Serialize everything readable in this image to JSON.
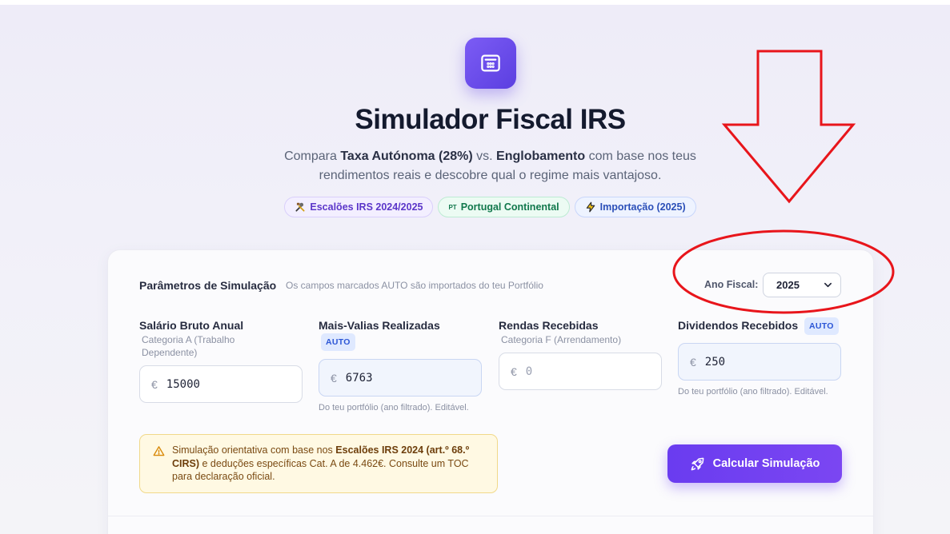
{
  "header": {
    "title": "Simulador Fiscal IRS",
    "subtitle_parts": {
      "p1": "Compara ",
      "b1": "Taxa Autónoma (28%)",
      "p2": " vs. ",
      "b2": "Englobamento",
      "p3": " com base nos teus rendimentos reais e descobre qual o regime mais vantajoso."
    },
    "badges": [
      {
        "icon": "tools-icon",
        "label": "Escalões IRS 2024/2025"
      },
      {
        "icon": "pt-flag-icon",
        "icon_text": "PT",
        "label": "Portugal Continental"
      },
      {
        "icon": "lightning-icon",
        "label": "Importação (2025)"
      }
    ]
  },
  "params": {
    "title": "Parâmetros de Simulação",
    "hint": "Os campos marcados AUTO são importados do teu Portfólio",
    "year_label": "Ano Fiscal:",
    "year_value": "2025"
  },
  "fields": [
    {
      "label": "Salário Bruto Anual",
      "sub": "Categoria A (Trabalho Dependente)",
      "currency": "€",
      "value": "15000",
      "auto": false
    },
    {
      "label": "Mais-Valias Realizadas",
      "auto_tag": "AUTO",
      "currency": "€",
      "value": "6763",
      "auto": true,
      "helper": "Do teu portfólio (ano filtrado). Editável."
    },
    {
      "label": "Rendas Recebidas",
      "sub": "Categoria F (Arrendamento)",
      "currency": "€",
      "placeholder": "0",
      "auto": false
    },
    {
      "label": "Dividendos Recebidos",
      "auto_tag": "AUTO",
      "currency": "€",
      "value": "250",
      "auto": true,
      "helper": "Do teu portfólio (ano filtrado). Editável."
    }
  ],
  "notice": {
    "p1": "Simulação orientativa com base nos ",
    "b1": "Escalões IRS 2024 (art.º 68.º CIRS)",
    "p2": " e deduções específicas Cat. A de 4.462€. Consulte um TOC para declaração oficial."
  },
  "actions": {
    "calculate_label": "Calcular Simulação"
  },
  "colors": {
    "accent": "#6a3cf0",
    "auto_tag": "#2c56d6",
    "annotation": "#e8151b"
  }
}
